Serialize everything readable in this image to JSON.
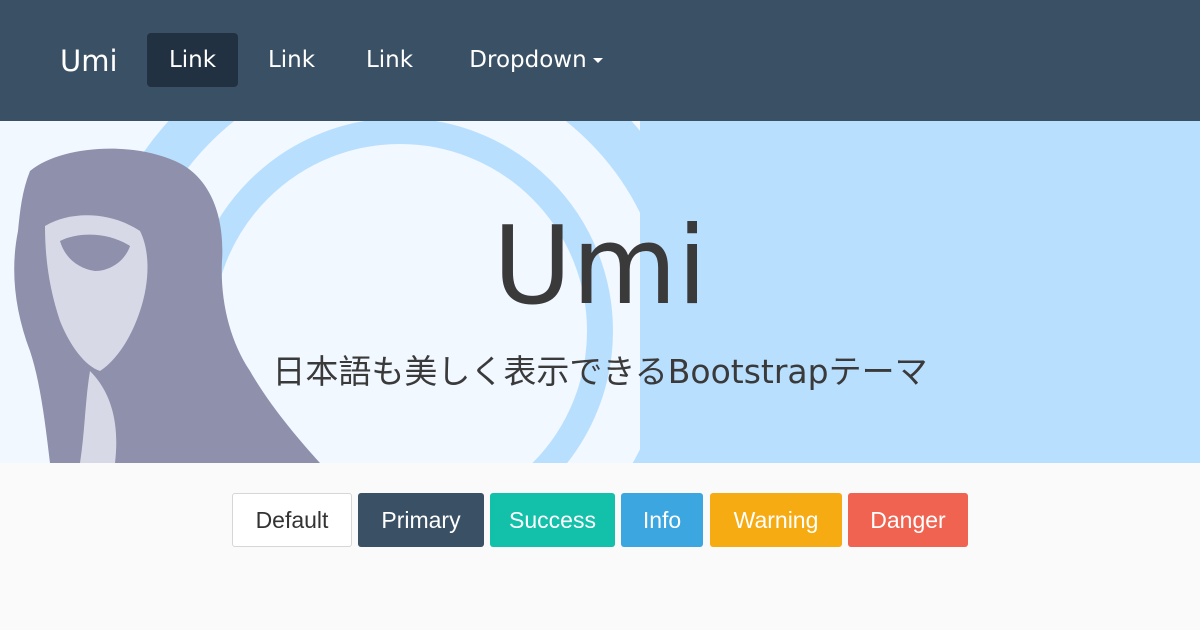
{
  "navbar": {
    "brand": "Umi",
    "links": [
      "Link",
      "Link",
      "Link"
    ],
    "dropdown_label": "Dropdown"
  },
  "hero": {
    "title": "Umi",
    "subtitle": "日本語も美しく表示できるBootstrapテーマ"
  },
  "buttons": {
    "default": "Default",
    "primary": "Primary",
    "success": "Success",
    "info": "Info",
    "warning": "Warning",
    "danger": "Danger"
  },
  "colors": {
    "navbar_bg": "#3a5064",
    "navbar_active": "#223142",
    "hero_bg": "#f2f8ff",
    "hero_accent": "#b9dfff",
    "figure": "#8e90ac",
    "primary": "#3a5064",
    "success": "#13c0a9",
    "info": "#3ba6e0",
    "warning": "#f7ab12",
    "danger": "#ef6350"
  }
}
